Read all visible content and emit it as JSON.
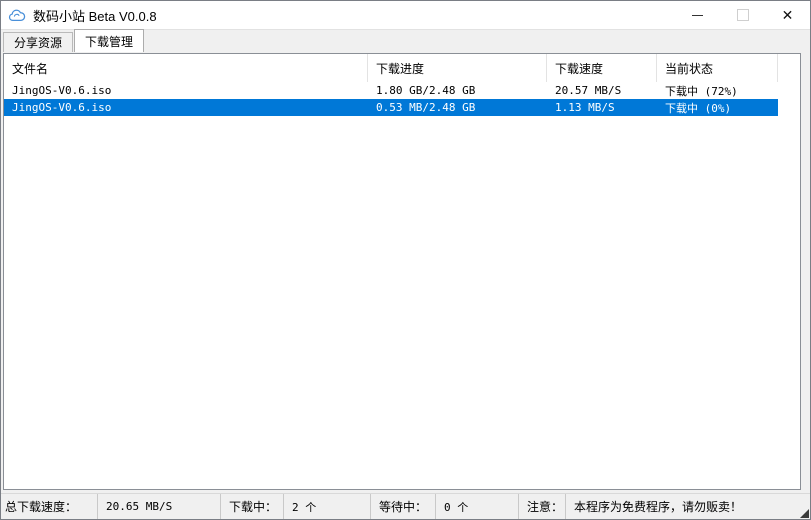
{
  "window": {
    "title": "数码小站 Beta V0.0.8"
  },
  "tabs": [
    {
      "label": "分享资源",
      "active": false
    },
    {
      "label": "下载管理",
      "active": true
    }
  ],
  "table": {
    "columns": [
      "文件名",
      "下载进度",
      "下载速度",
      "当前状态"
    ],
    "rows": [
      {
        "filename": "JingOS-V0.6.iso",
        "progress": "1.80 GB/2.48 GB",
        "speed": "20.57 MB/S",
        "status": "下载中 (72%)",
        "selected": false
      },
      {
        "filename": "JingOS-V0.6.iso",
        "progress": "0.53 MB/2.48 GB",
        "speed": "1.13 MB/S",
        "status": "下载中 (0%)",
        "selected": true
      }
    ]
  },
  "statusbar": {
    "total_speed_label": "总下载速度：",
    "total_speed_value": "20.65 MB/S",
    "downloading_label": "下载中：",
    "downloading_value": "2 个",
    "waiting_label": "等待中：",
    "waiting_value": "0 个",
    "notice_label": "注意：",
    "notice_value": "本程序为免费程序，请勿贩卖！"
  },
  "colors": {
    "selection_blue": "#0078d7",
    "titlebar_bg": "#ffffff",
    "window_bg": "#f0f0f0",
    "icon_blue": "#4a90d9"
  }
}
